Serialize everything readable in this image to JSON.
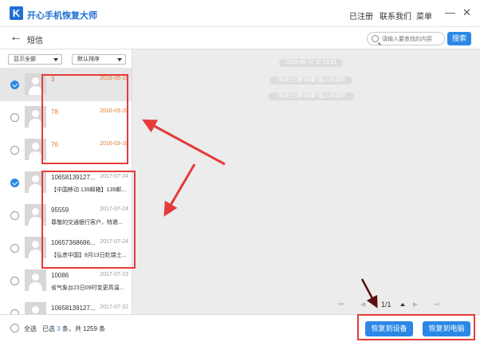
{
  "app": {
    "title": "开心手机恢复大师",
    "logo_letter": "K"
  },
  "header_links": {
    "registered": "已注册",
    "contact": "联系我们",
    "menu": "菜单"
  },
  "window_controls": {
    "minimize": "—",
    "close": "✕"
  },
  "nav": {
    "title": "短信"
  },
  "search": {
    "placeholder": "请输入要查找的内容",
    "button": "搜索"
  },
  "filters": {
    "show_all": "显示全部",
    "sort": "默认排序"
  },
  "messages": [
    {
      "name": "3",
      "date": "2016-05-10",
      "preview": "",
      "checked": true,
      "orange": true,
      "active": true
    },
    {
      "name": "78",
      "date": "2016-03-20",
      "preview": "",
      "checked": false,
      "orange": true,
      "active": false
    },
    {
      "name": "76",
      "date": "2016-03-10",
      "preview": "",
      "checked": false,
      "orange": true,
      "active": false
    },
    {
      "name": "10658139127...",
      "date": "2017-07-24",
      "preview": "【中国移动 139邮箱】139邮...",
      "checked": true,
      "orange": false,
      "active": false
    },
    {
      "name": "95559",
      "date": "2017-07-24",
      "preview": "尊敬的交通银行客户，特邀...",
      "checked": false,
      "orange": false,
      "active": false
    },
    {
      "name": "10657368686...",
      "date": "2017-07-24",
      "preview": "【弘彦中国】8月13日赴瑞士...",
      "checked": false,
      "orange": false,
      "active": false
    },
    {
      "name": "10086",
      "date": "2017-07-23",
      "preview": "省气象台23日09时变更高温...",
      "checked": false,
      "orange": false,
      "active": false
    },
    {
      "name": "10658139127...",
      "date": "2017-07-22",
      "preview": "",
      "checked": false,
      "orange": false,
      "active": false
    }
  ],
  "chat": {
    "timestamp": "2016-05-10 11:23:21",
    "lines": [
      "\"同桌\"已将\"同桌\"加入对话中",
      "\"同桌\"已将\"同桌\"加入对话中"
    ]
  },
  "pager": {
    "first": "⏮",
    "prev": "◀",
    "page": "1/1",
    "next": "▶",
    "last": "⏭"
  },
  "bottom": {
    "select_all": "全选",
    "selected_prefix": "已选 ",
    "selected_count": "3",
    "selected_suffix": " 条，共 1259 条",
    "restore_device": "恢复到设备",
    "restore_pc": "恢复到电脑"
  },
  "colors": {
    "accent": "#2b88e6",
    "annotation": "#e53b3b",
    "date_highlight": "#e6782a"
  }
}
